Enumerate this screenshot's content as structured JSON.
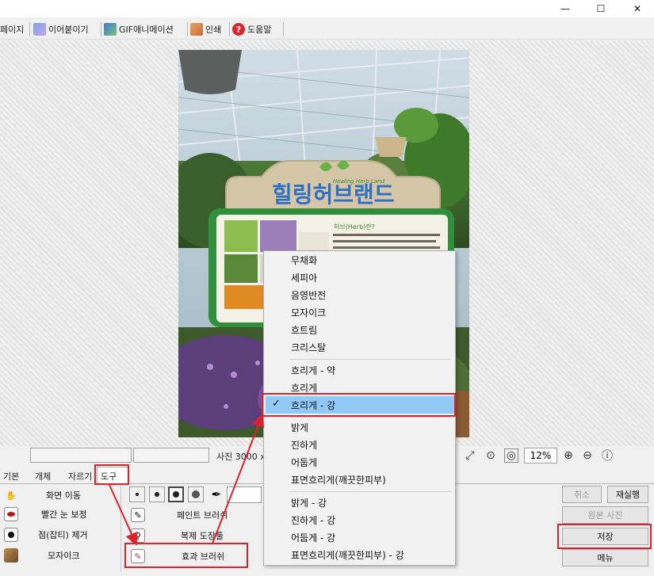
{
  "window": {
    "controls": {
      "minimize": "—",
      "maximize": "☐",
      "close": "✕"
    }
  },
  "toolbar": {
    "items": [
      {
        "label": "페이지",
        "icon": "page-icon"
      },
      {
        "label": "이어붙이기",
        "icon": "stitch-icon"
      },
      {
        "label": "GIF애니메이션",
        "icon": "gif-animation-icon"
      },
      {
        "label": "인쇄",
        "icon": "print-icon"
      },
      {
        "label": "도움말",
        "icon": "help-icon"
      }
    ]
  },
  "photo": {
    "sign_title": "힐링허브랜드",
    "sign_subtitle": "Healing Herb Land",
    "sign_heading": "허브(Herb)란?"
  },
  "status": {
    "photo_label": "사진 3000 x",
    "zoom": "12%"
  },
  "tabs": [
    {
      "label": "기본",
      "active": false
    },
    {
      "label": "개체",
      "active": false
    },
    {
      "label": "자르기",
      "active": false
    },
    {
      "label": "도구",
      "active": true
    }
  ],
  "tools_left": [
    {
      "label": "화면 이동",
      "icon": "hand-icon"
    },
    {
      "label": "빨간 눈 보정",
      "icon": "red-eye-icon"
    },
    {
      "label": "점(잡티) 제거",
      "icon": "spot-remove-icon"
    },
    {
      "label": "모자이크",
      "icon": "mosaic-icon"
    }
  ],
  "tools_right": [
    {
      "label": "페인트 브러쉬",
      "icon": "paint-brush-icon"
    },
    {
      "label": "복제 도장툴",
      "icon": "clone-stamp-icon"
    },
    {
      "label": "효과 브러쉬",
      "icon": "effect-brush-icon"
    }
  ],
  "buttons": {
    "cancel": "취소",
    "redo": "재실행",
    "original": "원본 사진",
    "save": "저장",
    "menu": "메뉴"
  },
  "context_menu": {
    "groups": [
      [
        "무채화",
        "세피아",
        "음영반전",
        "모자이크",
        "흐트림",
        "크리스탈"
      ],
      [
        "흐리게 - 약",
        "흐리게",
        "흐리게 - 강"
      ],
      [
        "밝게",
        "진하게",
        "어둡게",
        "표면흐리게(깨끗한피부)"
      ],
      [
        "밝게 - 강",
        "진하게 - 강",
        "어둡게 - 강",
        "표면흐리게(깨끗한피부) - 강"
      ]
    ],
    "checked": "흐리게 - 강"
  },
  "colors": {
    "highlight": "#e0202a",
    "menu_selected": "#91c9f7",
    "sign_green": "#2f8f3a"
  }
}
